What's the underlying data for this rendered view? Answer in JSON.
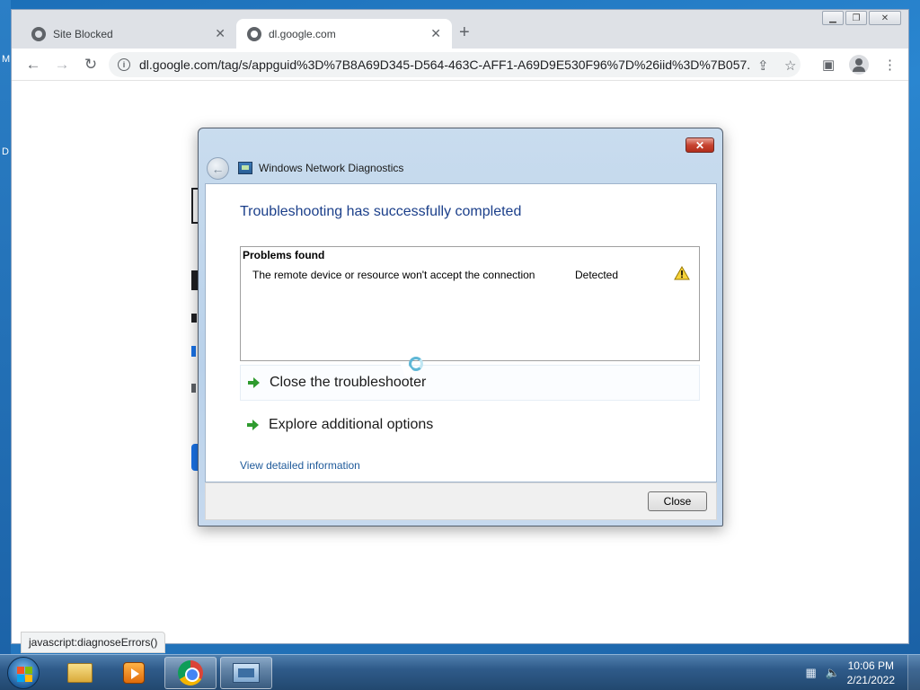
{
  "desktop": {
    "edge_letters": [
      "M",
      "D"
    ]
  },
  "browser": {
    "tabs": [
      {
        "title": "Site Blocked"
      },
      {
        "title": "dl.google.com"
      }
    ],
    "url": "dl.google.com/tag/s/appguid%3D%7B8A69D345-D564-463C-AFF1-A69D9E530F96%7D%26iid%3D%7B057...",
    "status_text": "javascript:diagnoseErrors()"
  },
  "dialog": {
    "title": "Windows Network Diagnostics",
    "heading": "Troubleshooting has successfully completed",
    "problems_header": "Problems found",
    "problems": [
      {
        "description": "The remote device or resource won't accept the connection",
        "status": "Detected",
        "icon": "warning-icon"
      }
    ],
    "options": [
      {
        "label": "Close the troubleshooter"
      },
      {
        "label": "Explore additional options"
      }
    ],
    "detail_link": "View detailed information",
    "close_button": "Close"
  },
  "taskbar": {
    "apps": [
      "folder-icon",
      "media-player-icon",
      "chrome-icon",
      "network-diagnostics-icon"
    ],
    "clock": {
      "time": "10:06 PM",
      "date": "2/21/2022"
    }
  },
  "colors": {
    "heading": "#1b3f8a",
    "link": "#1f5a9a",
    "option_arrow": "#2e9b2e",
    "taskbar": "#2f5b8a"
  }
}
